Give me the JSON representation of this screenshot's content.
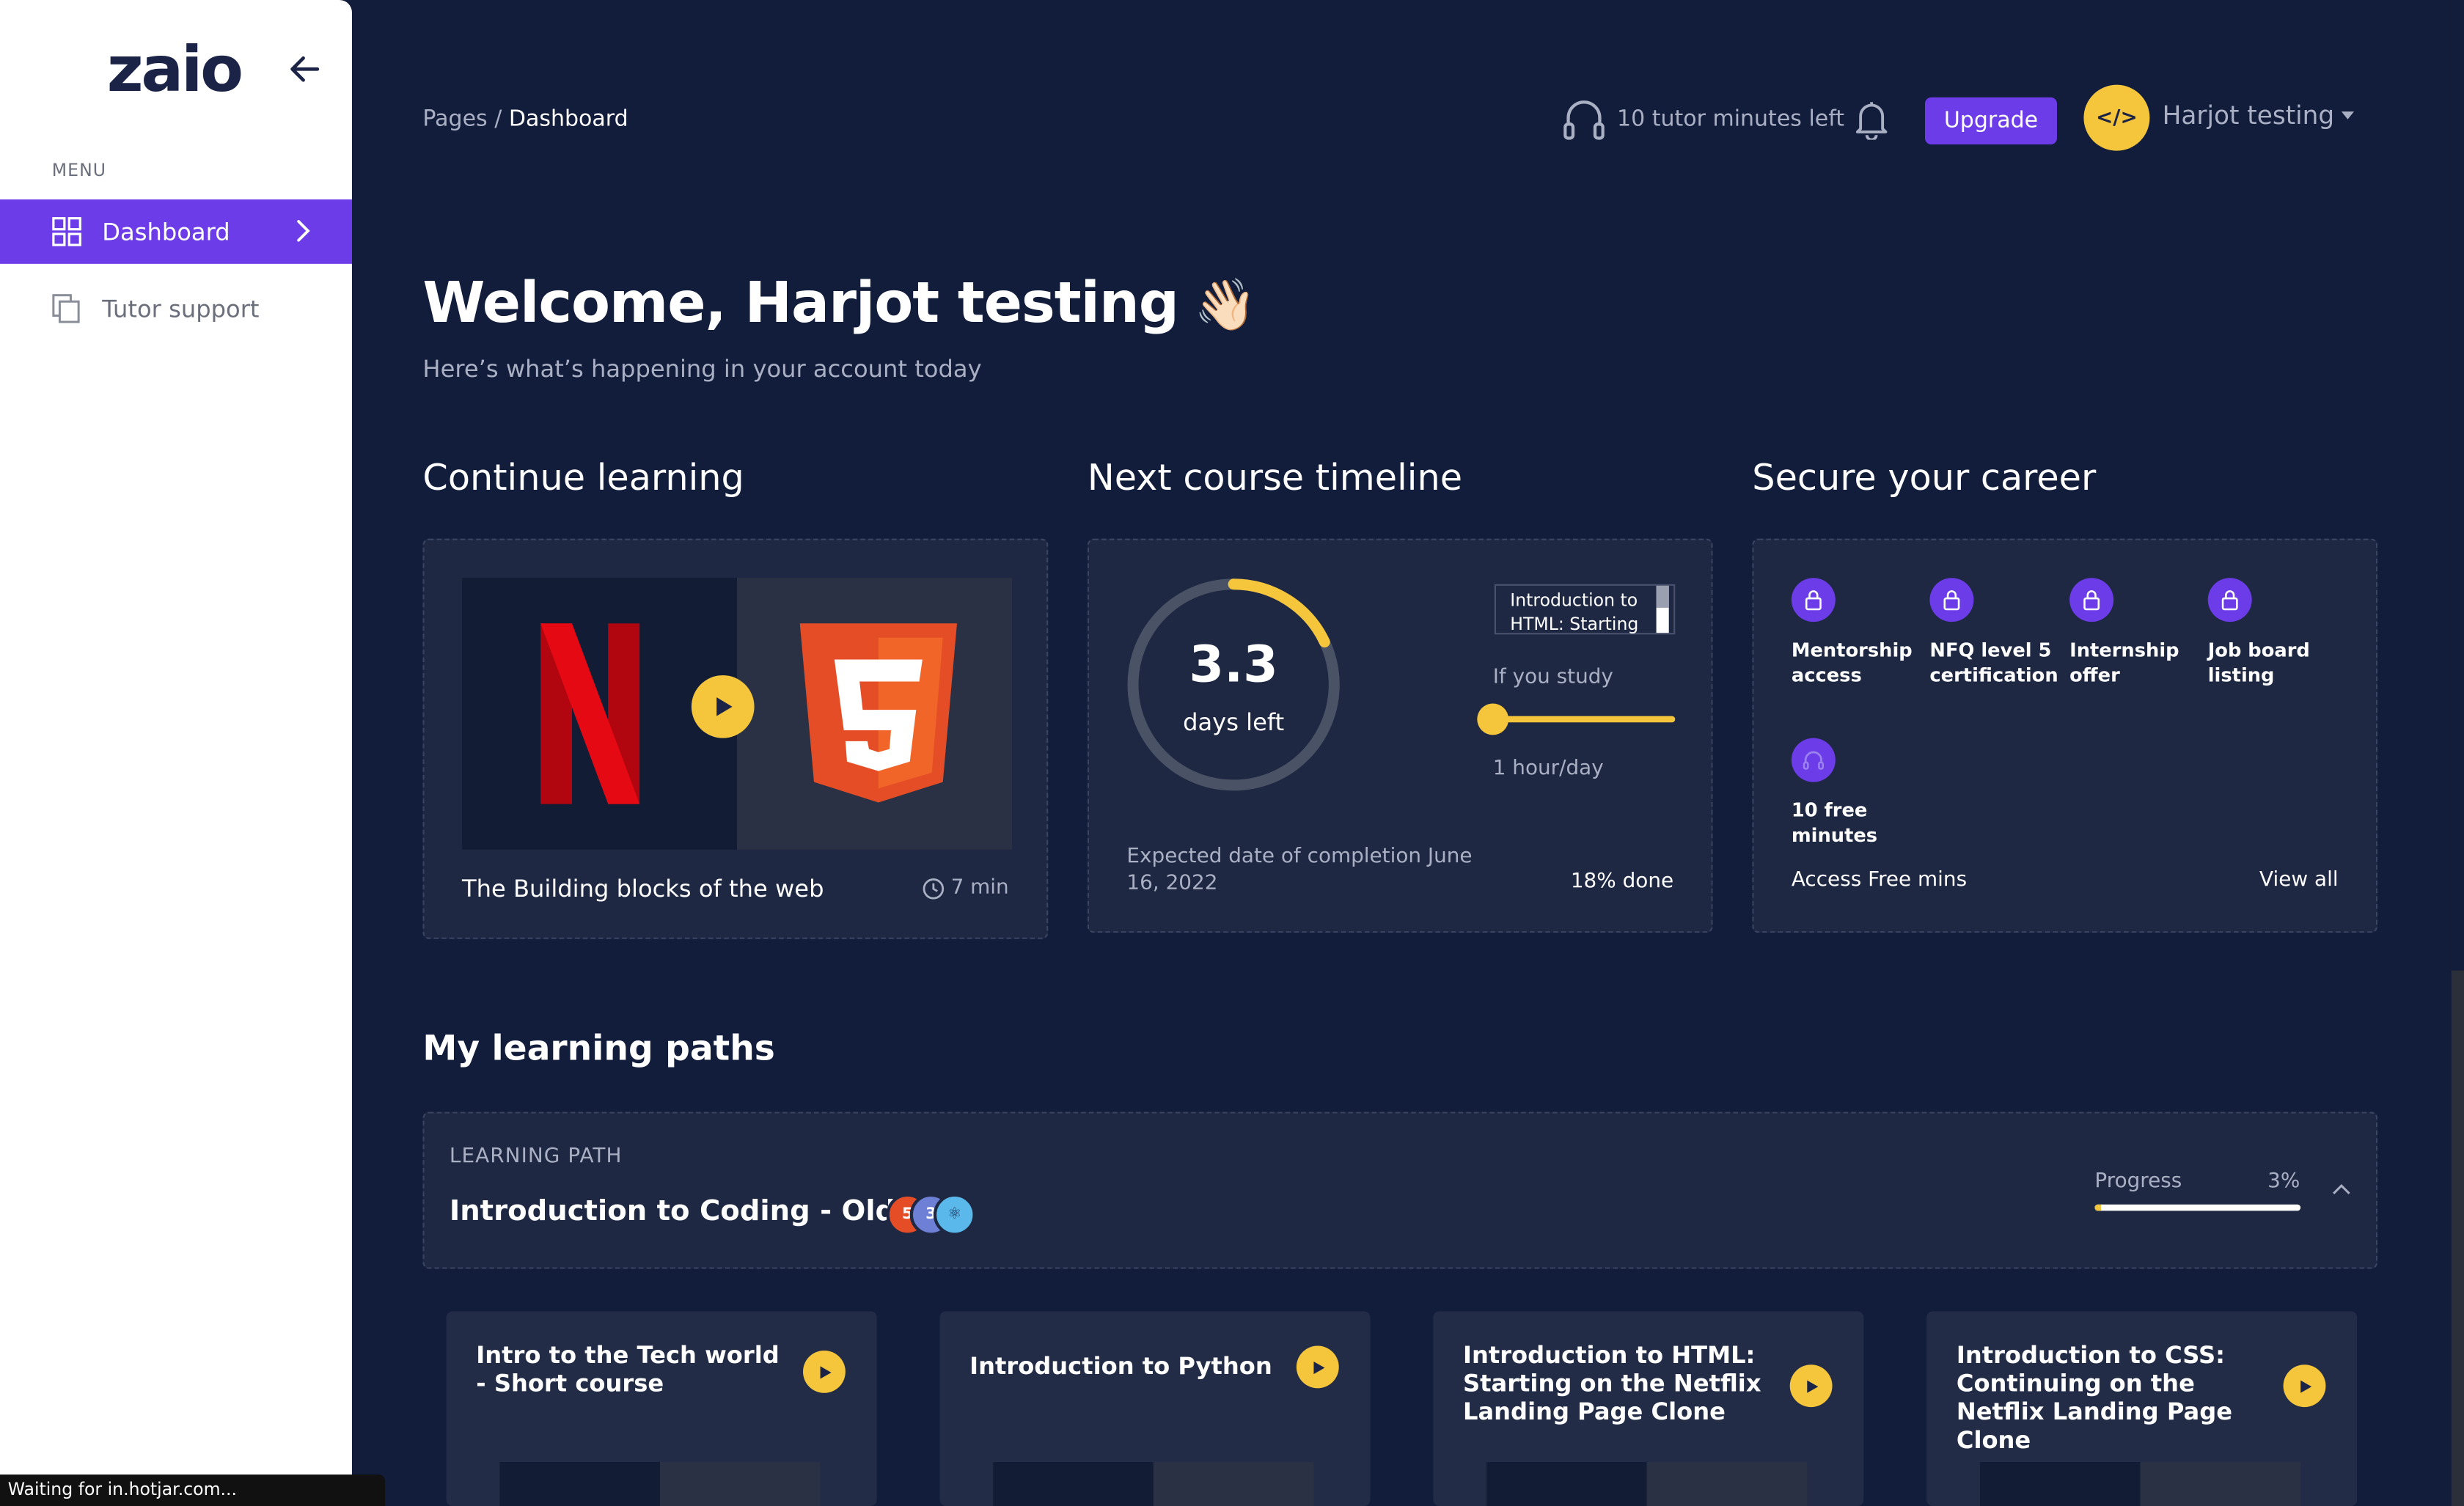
{
  "sidebar": {
    "logo": "zaio",
    "menu_label": "MENU",
    "items": [
      {
        "label": "Dashboard",
        "active": true,
        "icon": "grid-icon"
      },
      {
        "label": "Tutor support",
        "active": false,
        "icon": "copy-icon"
      }
    ]
  },
  "header": {
    "breadcrumb_root": "Pages",
    "breadcrumb_sep": " / ",
    "breadcrumb_current": "Dashboard",
    "tutor_minutes": "10 tutor minutes left",
    "upgrade_label": "Upgrade",
    "avatar_text": "</>",
    "username": "Harjot testing"
  },
  "welcome": {
    "title": "Welcome, Harjot testing",
    "emoji": "👋🏻",
    "subtitle": "Here’s what’s happening in your account today"
  },
  "continue_learning": {
    "heading": "Continue learning",
    "course_title": "The Building blocks of the web",
    "duration": "7 min"
  },
  "timeline": {
    "heading": "Next course timeline",
    "days": "3.3",
    "days_label": "days left",
    "days_progress_fraction": 0.18,
    "tooltip": "Introduction to HTML: Starting",
    "study_label": "If you study",
    "hours_label": "1 hour/day",
    "expected": "Expected date of completion June 16, 2022",
    "done": "18% done"
  },
  "career": {
    "heading": "Secure your career",
    "perks": [
      {
        "label": "Mentorship access",
        "icon": "lock-icon"
      },
      {
        "label": "NFQ level 5 certification",
        "icon": "lock-icon"
      },
      {
        "label": "Internship offer",
        "icon": "lock-icon"
      },
      {
        "label": "Job board listing",
        "icon": "lock-icon"
      },
      {
        "label": "10 free minutes",
        "icon": "headphones-icon"
      }
    ],
    "access_free": "Access Free mins",
    "view_all": "View all"
  },
  "learning_paths": {
    "heading": "My learning paths",
    "kicker": "LEARNING PATH",
    "path_title": "Introduction to Coding - Old",
    "progress_label": "Progress",
    "progress_value": "3%",
    "progress_fraction": 0.03,
    "courses": [
      {
        "title": "Intro to the Tech world - Short course"
      },
      {
        "title": "Introduction to Python"
      },
      {
        "title": "Introduction to HTML: Starting on the Netflix Landing Page Clone"
      },
      {
        "title": "Introduction to CSS: Continuing on the Netflix Landing Page Clone"
      }
    ]
  },
  "browser_status": "Waiting for in.hotjar.com...",
  "colors": {
    "background": "#121c3b",
    "card": "#1e2843",
    "accent_purple": "#6c3ce8",
    "accent_yellow": "#f5c63b"
  }
}
